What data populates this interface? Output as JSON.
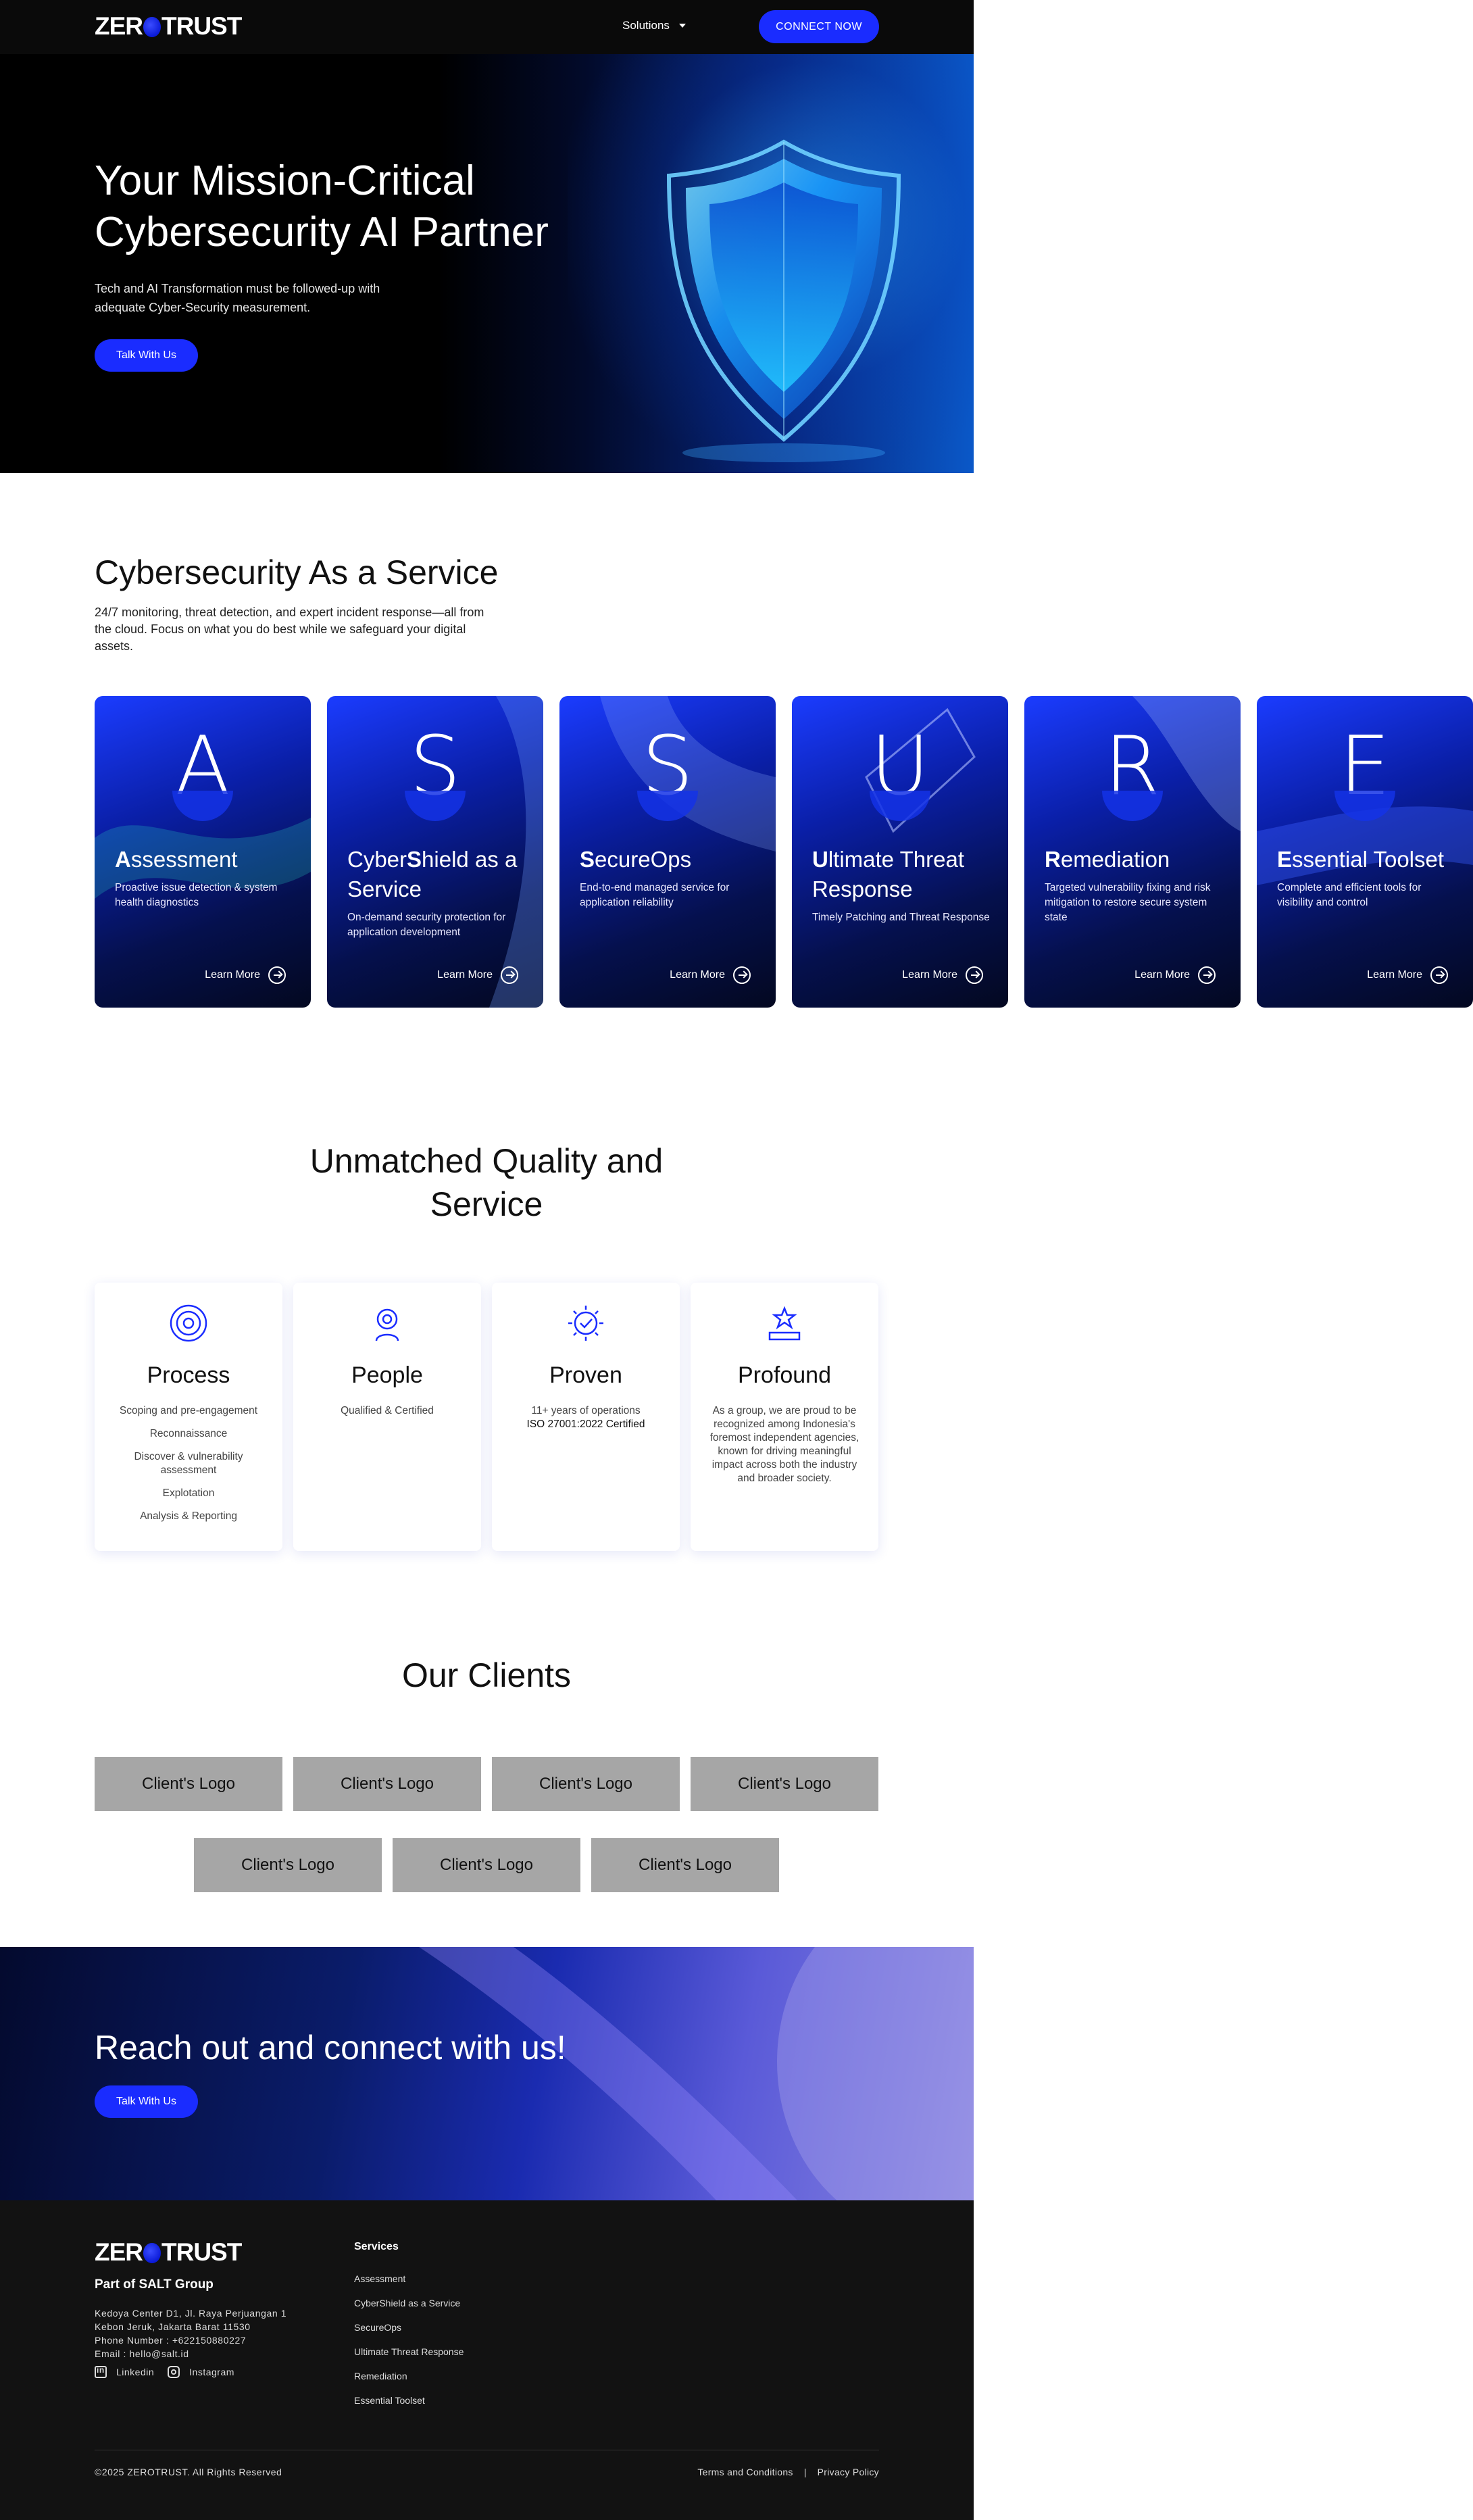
{
  "nav": {
    "logo": {
      "part1": "ZER",
      "part2": "TRUST"
    },
    "solutions_label": "Solutions",
    "connect_label": "CONNECT NOW"
  },
  "hero": {
    "title": "Your Mission-Critical Cybersecurity AI Partner",
    "subtitle": "Tech and AI Transformation must be followed-up with adequate Cyber-Security measurement.",
    "cta_label": "Talk With Us"
  },
  "caas": {
    "title": "Cybersecurity As a Service",
    "description": "24/7 monitoring, threat detection, and expert incident response—all from the cloud. Focus on what you do best while we safeguard your digital assets.",
    "learn_more": "Learn More",
    "cards": [
      {
        "letter": "A",
        "title_bold": "A",
        "title_rest": "ssessment",
        "title_pre": "",
        "desc": "Proactive issue detection & system health diagnostics"
      },
      {
        "letter": "S",
        "title_pre": "Cyber",
        "title_bold": "S",
        "title_rest": "hield as a Service",
        "desc": "On-demand security protection for application development"
      },
      {
        "letter": "S",
        "title_pre": "",
        "title_bold": "S",
        "title_rest": "ecureOps",
        "desc": "End-to-end managed service for application reliability"
      },
      {
        "letter": "U",
        "title_pre": "",
        "title_bold": "U",
        "title_rest": "ltimate Threat Response",
        "desc": "Timely Patching and Threat Response"
      },
      {
        "letter": "R",
        "title_pre": "",
        "title_bold": "R",
        "title_rest": "emediation",
        "desc": "Targeted vulnerability fixing and risk mitigation to restore secure system state"
      },
      {
        "letter": "E",
        "title_pre": "",
        "title_bold": "E",
        "title_rest": "ssential Toolset",
        "desc": "Complete and efficient tools for visibility and control"
      }
    ]
  },
  "quality": {
    "title": "Unmatched Quality and Service",
    "cards": [
      {
        "title": "Process",
        "icon": "process-icon",
        "lines": [
          "Scoping and pre-engagement",
          "Reconnaissance",
          "Discover & vulnerability assessment",
          "Explotation",
          "Analysis & Reporting"
        ]
      },
      {
        "title": "People",
        "icon": "people-icon",
        "lines": [
          "Qualified & Certified"
        ]
      },
      {
        "title": "Proven",
        "icon": "proven-icon",
        "line1": "11+ years of operations",
        "line2": "ISO 27001:2022 Certified"
      },
      {
        "title": "Profound",
        "icon": "profound-icon",
        "text": "As a group, we are proud to be recognized among Indonesia's foremost independent agencies, known for driving meaningful impact across both the industry and broader society."
      }
    ]
  },
  "clients": {
    "title": "Our Clients",
    "logos": [
      "Client's Logo",
      "Client's Logo",
      "Client's Logo",
      "Client's Logo",
      "Client's Logo",
      "Client's Logo",
      "Client's Logo"
    ]
  },
  "cta": {
    "title": "Reach out and connect with us!",
    "button": "Talk With Us"
  },
  "footer": {
    "group": "Part of SALT Group",
    "address1": "Kedoya Center D1, Jl. Raya Perjuangan 1",
    "address2": "Kebon Jeruk, Jakarta Barat 11530",
    "phone": "Phone Number : +622150880227",
    "email": "Email : hello@salt.id",
    "linkedin": "Linkedin",
    "instagram": "Instagram",
    "services_title": "Services",
    "services": [
      "Assessment",
      "CyberShield as a Service",
      "SecureOps",
      "Ultimate Threat Response",
      "Remediation",
      "Essential Toolset"
    ],
    "copyright": "©2025 ZEROTRUST. All Rights Reserved",
    "terms": "Terms and Conditions",
    "separator": "|",
    "privacy": "Privacy Policy"
  },
  "colors": {
    "accent": "#1a2cff",
    "dark": "#0a0a0a",
    "footer": "#121212",
    "logo_box": "#a6a6a6"
  }
}
